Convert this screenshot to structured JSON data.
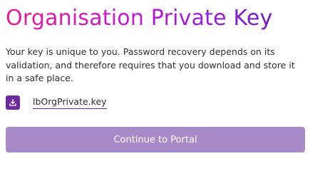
{
  "page": {
    "title": "Organisation Private Key",
    "description": "Your key is unique to you. Password recovery depends on its validation, and therefore requires that you download and store it in a safe place."
  },
  "download": {
    "icon": "download-icon",
    "filename": "lbOrgPrivate.key"
  },
  "actions": {
    "continue_label": "Continue to Portal"
  },
  "colors": {
    "title_gradient_start": "#ee1a8f",
    "title_gradient_end": "#6a1bc1",
    "accent": "#6c2a9c",
    "button_bg": "#a98ac9",
    "button_text": "#ffffff"
  }
}
